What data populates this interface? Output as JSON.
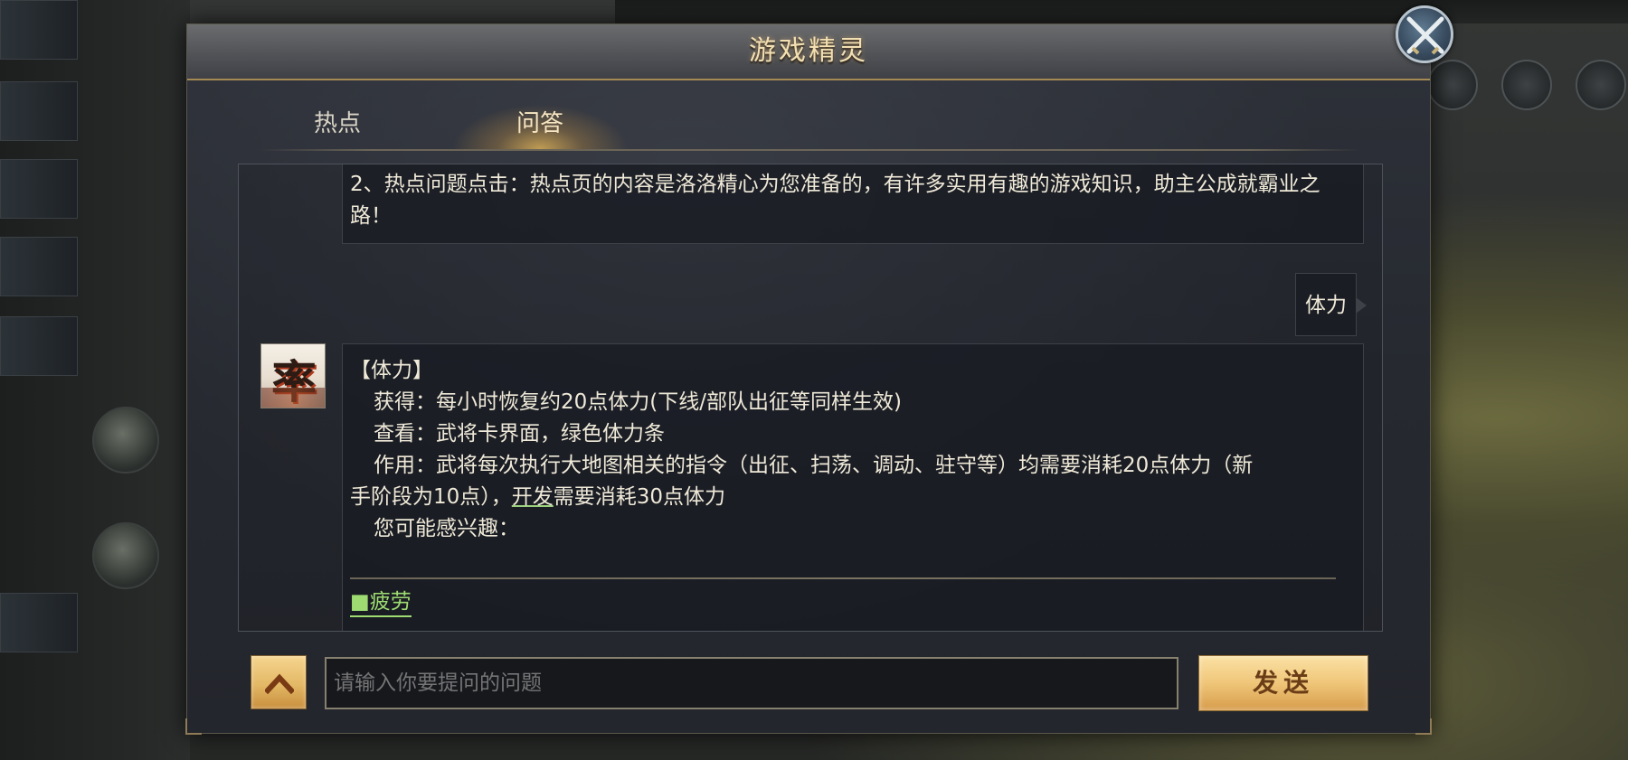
{
  "dialog": {
    "title": "游戏精灵"
  },
  "tabs": [
    {
      "label": "热点",
      "active": false
    },
    {
      "label": "问答",
      "active": true
    }
  ],
  "messages": {
    "hotpage_tip": "2、热点问题点击：热点页的内容是洛洛精心为您准备的，有许多实用有趣的游戏知识，助主公成就霸业之路！",
    "user_query": "体力",
    "avatar_glyph": "率",
    "answer": {
      "heading": "【体力】",
      "obtain_label": "获得：",
      "obtain_text": "每小时恢复约20点体力(下线/部队出征等同样生效)",
      "view_label": "查看：",
      "view_text": "武将卡界面，绿色体力条",
      "effect_label": "作用：",
      "effect_text_1": "武将每次执行大地图相关的指令（出征、扫荡、调动、驻守等）均需要消耗20点体力（新",
      "effect_text_2_pre": "手阶段为10点），",
      "effect_link": "开发",
      "effect_text_2_post": "需要消耗30点体力",
      "interest_label": "您可能感兴趣：",
      "related_link": "■疲劳"
    }
  },
  "input": {
    "placeholder": "请输入你要提问的问题",
    "value": ""
  },
  "send_button": "发送",
  "colors": {
    "title_gold": "#f2dfb2",
    "button_gold": "#efc679",
    "link_green": "#9edc72"
  }
}
